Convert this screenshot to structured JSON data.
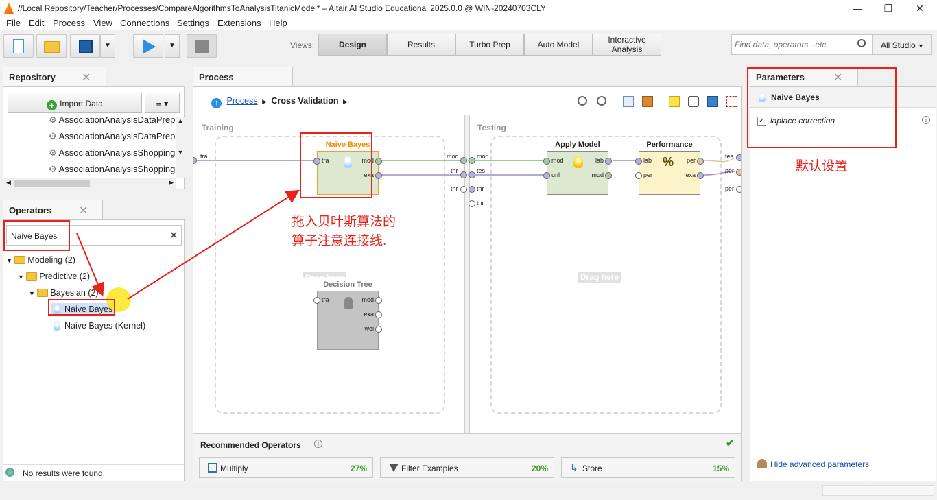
{
  "window": {
    "title": "//Local Repository/Teacher/Processes/CompareAlgorithmsToAnalysisTitanicModel* – Altair AI Studio Educational 2025.0.0 @ WIN-20240703CLY",
    "minimize": "—",
    "restore": "❐",
    "close": "✕"
  },
  "menu": [
    "File",
    "Edit",
    "Process",
    "View",
    "Connections",
    "Settings",
    "Extensions",
    "Help"
  ],
  "toolbar": {
    "views_label": "Views:",
    "views": [
      "Design",
      "Results",
      "Turbo Prep",
      "Auto Model",
      "Interactive Analysis"
    ],
    "active_view": "Design",
    "search_placeholder": "Find data, operators...etc",
    "scope": "All Studio"
  },
  "repository": {
    "tab": "Repository",
    "import_label": "Import Data",
    "items": [
      "AssociationAnalysisDataPrep",
      "AssociationAnalysisDataPrep",
      "AssociationAnalysisShopping",
      "AssociationAnalysisShopping"
    ]
  },
  "operators": {
    "tab": "Operators",
    "search_value": "Naive Bayes",
    "tree": [
      {
        "label": "Modeling (2)",
        "level": 0
      },
      {
        "label": "Predictive (2)",
        "level": 1
      },
      {
        "label": "Bayesian (2)",
        "level": 2
      },
      {
        "label": "Naive Bayes",
        "level": 3
      },
      {
        "label": "Naive Bayes (Kernel)",
        "level": 3
      }
    ],
    "status": "No results were found."
  },
  "process": {
    "tab": "Process",
    "breadcrumb_root": "Process",
    "breadcrumb_current": "Cross Validation",
    "training_label": "Training",
    "testing_label": "Testing",
    "drag_here": "Drag here",
    "drag_here_partial": "Drag here",
    "ops": {
      "naive_bayes": {
        "name": "Naive Bayes",
        "ports": [
          "tra",
          "mod",
          "exa"
        ]
      },
      "decision_tree": {
        "name": "Decision Tree",
        "ports": [
          "tra",
          "mod",
          "exa",
          "wei"
        ]
      },
      "apply_model": {
        "name": "Apply Model",
        "ports": [
          "mod",
          "unl",
          "lab",
          "mod"
        ]
      },
      "performance": {
        "name": "Performance",
        "ports": [
          "lab",
          "per",
          "per",
          "exa"
        ]
      }
    },
    "left_ports": {
      "tra": "tra",
      "mod": "mod",
      "thr1": "thr",
      "thr2": "thr"
    },
    "test_ports": {
      "mod": "mod",
      "tes": "tes",
      "thr1": "thr",
      "thr2": "thr"
    },
    "right_ports": [
      "tes",
      "per",
      "per"
    ]
  },
  "recommended": {
    "title": "Recommended Operators",
    "items": [
      {
        "label": "Multiply",
        "pct": "27%"
      },
      {
        "label": "Filter Examples",
        "pct": "20%"
      },
      {
        "label": "Store",
        "pct": "15%"
      }
    ]
  },
  "parameters": {
    "tab": "Parameters",
    "operator": "Naive Bayes",
    "param": "laplace correction",
    "checked": true,
    "hide_advanced": "Hide advanced parameters"
  },
  "annotations": {
    "drag_note_1": "拖入贝叶斯算法的",
    "drag_note_2": "算子注意连接线.",
    "default_note": "默认设置"
  },
  "colors": {
    "accent": "#e8211a",
    "op_green": "#dde8d0",
    "op_yellow": "#fdf3c9",
    "op_gray": "#c4c4c4",
    "nb_title": "#f08c00"
  }
}
